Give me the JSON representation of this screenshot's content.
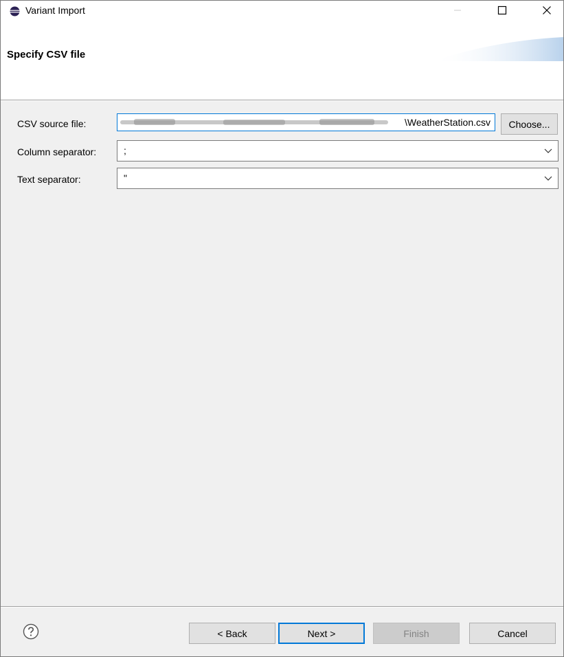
{
  "window": {
    "title": "Variant Import",
    "controls": {
      "minimize": "minimize-icon",
      "maximize": "maximize-icon",
      "close": "close-icon"
    }
  },
  "header": {
    "title": "Specify CSV file"
  },
  "form": {
    "csv_source": {
      "label": "CSV source file:",
      "value": "\\WeatherStation.csv",
      "button_label": "Choose..."
    },
    "column_separator": {
      "label": "Column separator:",
      "value": ";"
    },
    "text_separator": {
      "label": "Text separator:",
      "value": "\""
    }
  },
  "footer": {
    "help_icon": "help-icon",
    "back_label": "< Back",
    "next_label": "Next >",
    "finish_label": "Finish",
    "cancel_label": "Cancel"
  },
  "colors": {
    "accent": "#0078d7",
    "window_bg": "#f0f0f0",
    "banner": "#c7dbef"
  }
}
